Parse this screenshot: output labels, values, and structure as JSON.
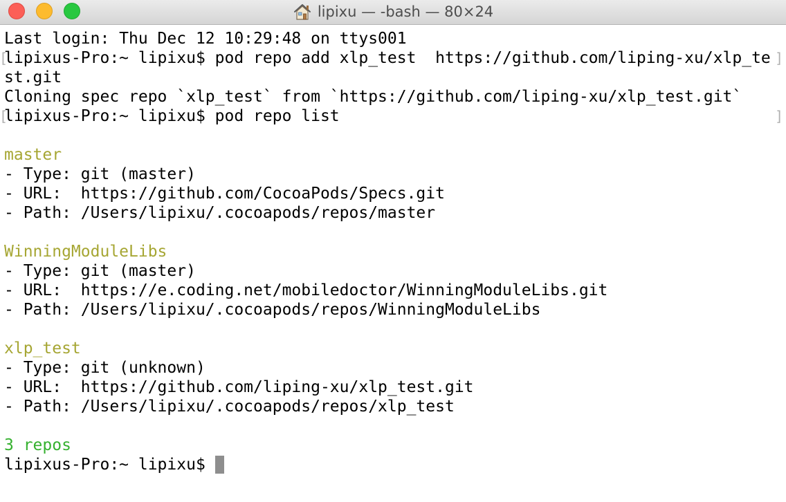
{
  "window": {
    "title": "lipixu — -bash — 80×24"
  },
  "terminal": {
    "lines": [
      {
        "text": "Last login: Thu Dec 12 10:29:48 on ttys001",
        "style": "normal"
      },
      {
        "text": "lipixus-Pro:~ lipixu$ pod repo add xlp_test  https://github.com/liping-xu/xlp_te",
        "style": "normal"
      },
      {
        "text": "st.git",
        "style": "normal"
      },
      {
        "text": "Cloning spec repo `xlp_test` from `https://github.com/liping-xu/xlp_test.git`",
        "style": "normal"
      },
      {
        "text": "lipixus-Pro:~ lipixu$ pod repo list",
        "style": "normal"
      },
      {
        "text": "",
        "style": "normal"
      },
      {
        "text": "master",
        "style": "yellow"
      },
      {
        "text": "- Type: git (master)",
        "style": "normal"
      },
      {
        "text": "- URL:  https://github.com/CocoaPods/Specs.git",
        "style": "normal"
      },
      {
        "text": "- Path: /Users/lipixu/.cocoapods/repos/master",
        "style": "normal"
      },
      {
        "text": "",
        "style": "normal"
      },
      {
        "text": "WinningModuleLibs",
        "style": "yellow"
      },
      {
        "text": "- Type: git (master)",
        "style": "normal"
      },
      {
        "text": "- URL:  https://e.coding.net/mobiledoctor/WinningModuleLibs.git",
        "style": "normal"
      },
      {
        "text": "- Path: /Users/lipixu/.cocoapods/repos/WinningModuleLibs",
        "style": "normal"
      },
      {
        "text": "",
        "style": "normal"
      },
      {
        "text": "xlp_test",
        "style": "yellow"
      },
      {
        "text": "- Type: git (unknown)",
        "style": "normal"
      },
      {
        "text": "- URL:  https://github.com/liping-xu/xlp_test.git",
        "style": "normal"
      },
      {
        "text": "- Path: /Users/lipixu/.cocoapods/repos/xlp_test",
        "style": "normal"
      },
      {
        "text": "",
        "style": "normal"
      },
      {
        "text": "3 repos",
        "style": "green"
      },
      {
        "text": "lipixus-Pro:~ lipixu$ ",
        "style": "normal"
      }
    ],
    "bracket_lines": [
      1,
      4
    ],
    "cursor_line": 22
  },
  "colors": {
    "repo_name": "#a6a633",
    "repo_count": "#35b12f",
    "cursor": "#8e8e8e",
    "close": "#fc5f57",
    "minimize": "#fdbb2e",
    "zoom": "#28c840"
  },
  "icons": {
    "title": "home-icon"
  }
}
